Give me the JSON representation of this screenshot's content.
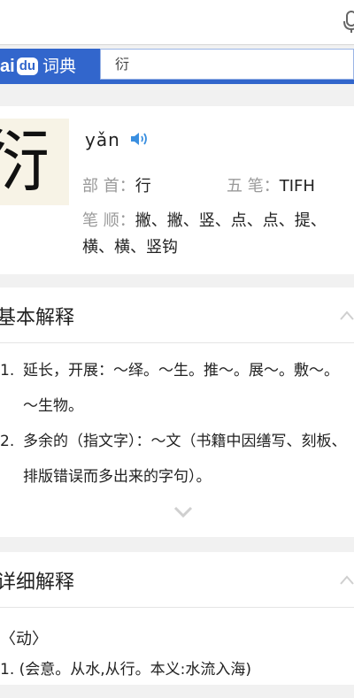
{
  "header": {
    "logo_bai": "ai",
    "logo_du": "du",
    "logo_sub": "词典",
    "search_value": "衍"
  },
  "entry": {
    "character": "衍",
    "pinyin": "yǎn",
    "bushou_label": "部 首：",
    "bushou_value": "行",
    "wubi_label": "五 笔：",
    "wubi_value": "TIFH",
    "bishun_label": "笔 顺：",
    "bishun_value": "撇、撇、竖、点、点、提、横、横、竖钩"
  },
  "basic": {
    "title": "基本解释",
    "items": [
      {
        "num": "1.",
        "text": "延长，开展：～绎。～生。推～。展～。敷～。～生物。"
      },
      {
        "num": "2.",
        "text": "多余的（指文字）：～文（书籍中因缮写、刻板、排版错误而多出来的字句）。"
      }
    ]
  },
  "detail": {
    "title": "详细解释",
    "pos": "〈动〉",
    "items": [
      {
        "num": "1.",
        "text": "(会意。从水,从行。本义:水流入海)"
      }
    ]
  },
  "colors": {
    "brand_blue": "#3266cc",
    "speaker": "#3a8fe0"
  }
}
